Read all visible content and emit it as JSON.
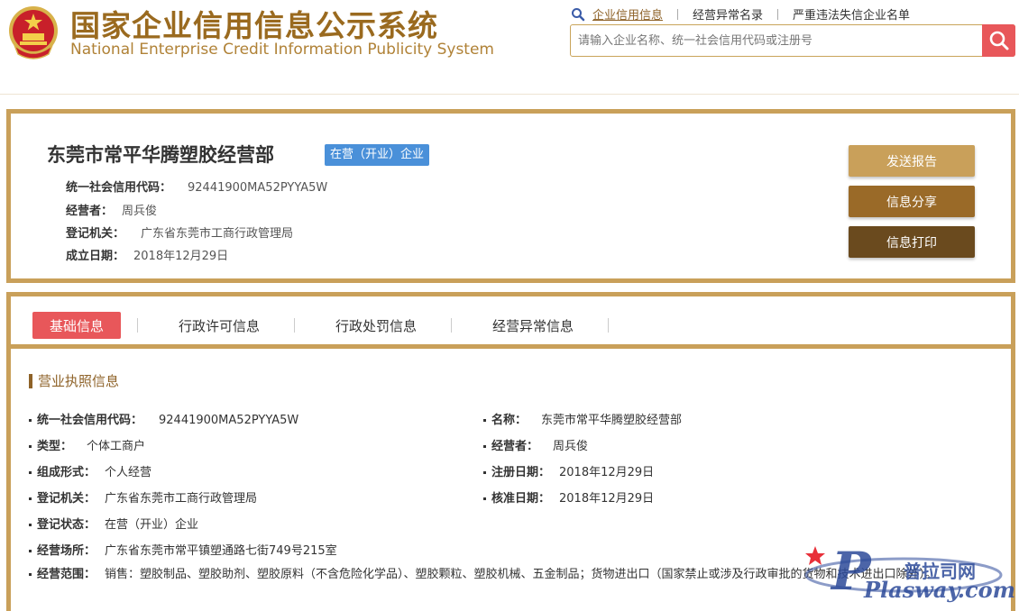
{
  "header": {
    "title_cn": "国家企业信用信息公示系统",
    "title_en": "National Enterprise Credit Information Publicity System",
    "links": [
      "企业信用信息",
      "经营异常名录",
      "严重违法失信企业名单"
    ],
    "search_placeholder": "请输入企业名称、统一社会信用代码或注册号"
  },
  "summary": {
    "company_name": "东莞市常平华腾塑胶经营部",
    "status_badge": "在营（开业）企业",
    "credit_code_label": "统一社会信用代码：",
    "credit_code": "92441900MA52PYYA5W",
    "operator_label": "经营者：",
    "operator": "周兵俊",
    "authority_label": "登记机关：",
    "authority": "广东省东莞市工商行政管理局",
    "founded_label": "成立日期：",
    "founded": "2018年12月29日",
    "buttons": {
      "send": "发送报告",
      "share": "信息分享",
      "print": "信息打印"
    }
  },
  "tabs": [
    "基础信息",
    "行政许可信息",
    "行政处罚信息",
    "经营异常信息"
  ],
  "license": {
    "section_title": "营业执照信息",
    "credit_code_label": "统一社会信用代码：",
    "credit_code": "92441900MA52PYYA5W",
    "name_label": "名称：",
    "name": "东莞市常平华腾塑胶经营部",
    "type_label": "类型：",
    "type": "个体工商户",
    "operator_label": "经营者：",
    "operator": "周兵俊",
    "form_label": "组成形式：",
    "form": "个人经营",
    "reg_date_label": "注册日期：",
    "reg_date": "2018年12月29日",
    "authority_label": "登记机关：",
    "authority": "广东省东莞市工商行政管理局",
    "approval_date_label": "核准日期：",
    "approval_date": "2018年12月29日",
    "status_label": "登记状态：",
    "status": "在营（开业）企业",
    "address_label": "经营场所：",
    "address": "广东省东莞市常平镇塑通路七街749号215室",
    "scope_label": "经营范围：",
    "scope": "销售：塑胶制品、塑胶助剂、塑胶原料（不含危险化学品）、塑胶颗粒、塑胶机械、五金制品；货物进出口（国家禁止或涉及行政审批的货物和技术进出口除外）。"
  },
  "watermark": {
    "text_cn": "普拉司网",
    "text_en": "Plasway.com"
  },
  "colors": {
    "gold": "#c9a05a",
    "brown": "#9a6a28",
    "dark_brown": "#6a4a1e",
    "red": "#e8575a",
    "blue": "#4a90d9"
  }
}
